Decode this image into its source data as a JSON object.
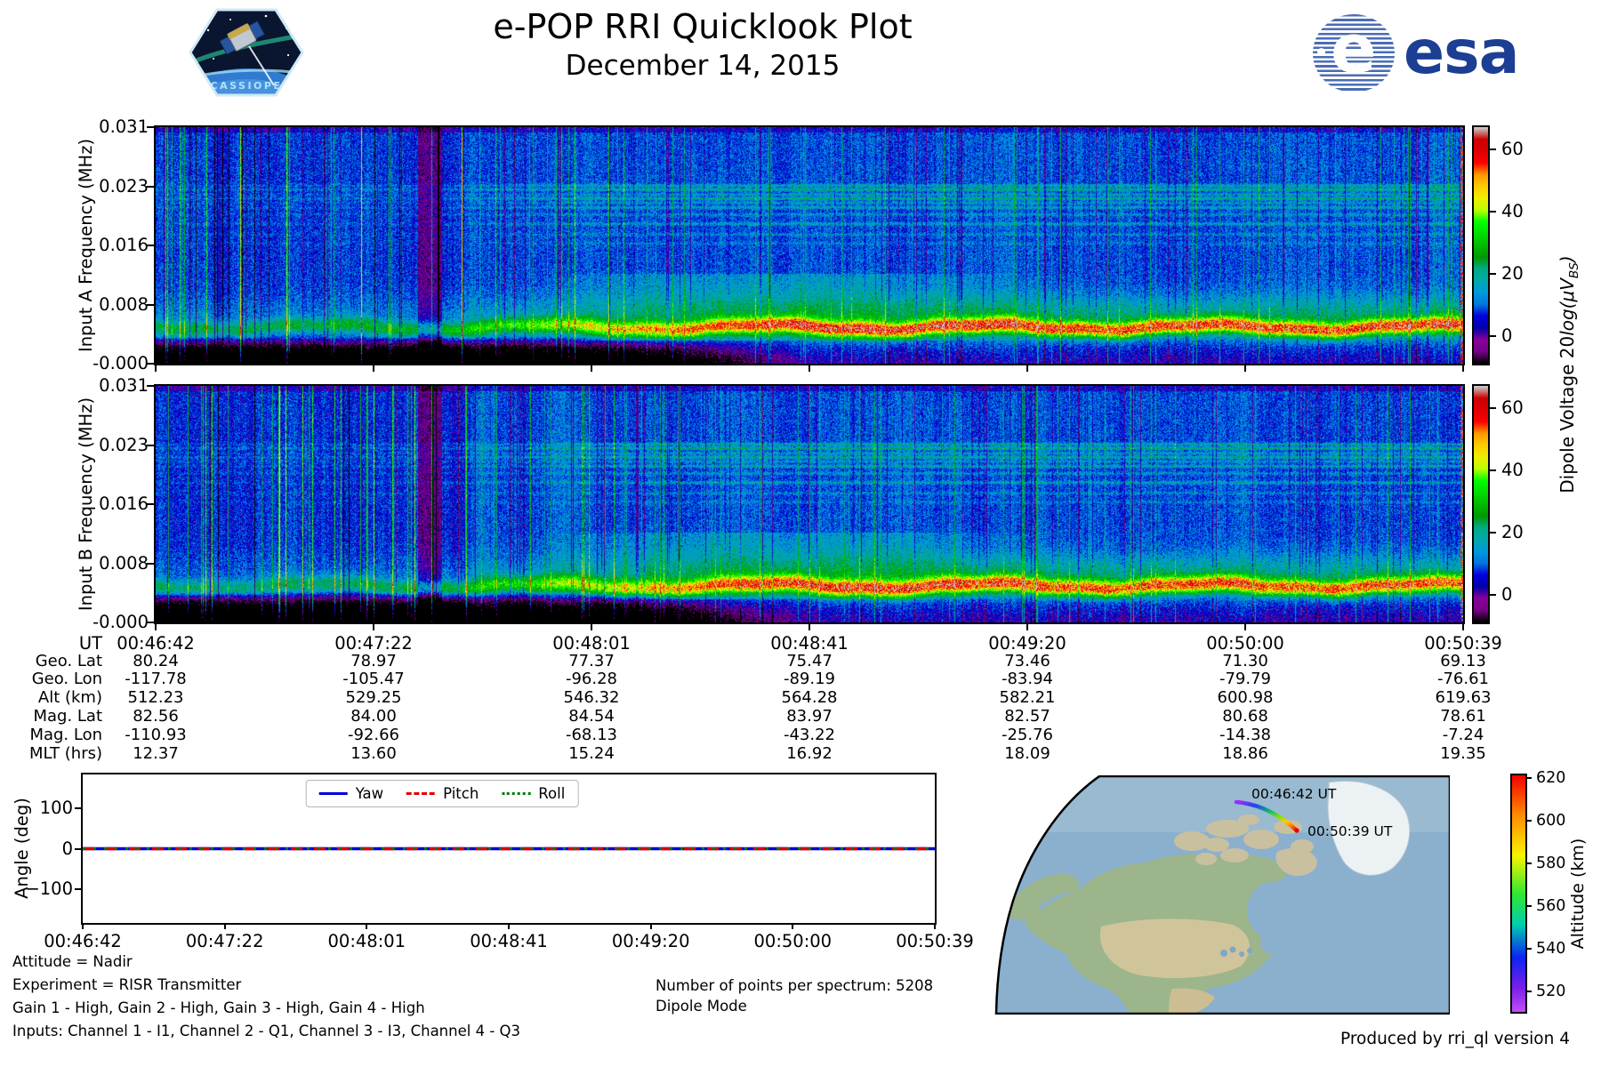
{
  "page": {
    "produced_by": "Produced by rri_ql version 4"
  },
  "colors": {
    "esa_blue": "#1c3f93",
    "accent_black": "#000000"
  },
  "header": {
    "title": "e-POP RRI Quicklook Plot",
    "subtitle": "December 14, 2015",
    "cassiope_badge_label": "CASSIOPE",
    "esa_wordmark": "esa"
  },
  "spectrogram_a": {
    "ylabel": "Input A Frequency (MHz)",
    "yticks": [
      "0.031",
      "0.023",
      "0.016",
      "0.008",
      "-0.000"
    ]
  },
  "spectrogram_b": {
    "ylabel": "Input B Frequency (MHz)",
    "yticks": [
      "0.031",
      "0.023",
      "0.016",
      "0.008",
      "-0.000"
    ]
  },
  "dipole_colorbar": {
    "ticks": [
      "60",
      "40",
      "20",
      "0"
    ],
    "tick_values": [
      60,
      40,
      20,
      0
    ],
    "vmin": -9,
    "vmax": 67,
    "label_prefix": "Dipole Voltage 20",
    "label_log": "log",
    "label_open": "(μV",
    "label_sub": "BS",
    "label_close": ")"
  },
  "ephemeris": {
    "row_labels": [
      "UT",
      "Geo. Lat",
      "Geo. Lon",
      "Alt (km)",
      "Mag. Lat",
      "Mag. Lon",
      "MLT (hrs)"
    ],
    "columns": [
      [
        "00:46:42",
        "80.24",
        "-117.78",
        "512.23",
        "82.56",
        "-110.93",
        "12.37"
      ],
      [
        "00:47:22",
        "78.97",
        "-105.47",
        "529.25",
        "84.00",
        "-92.66",
        "13.60"
      ],
      [
        "00:48:01",
        "77.37",
        "-96.28",
        "546.32",
        "84.54",
        "-68.13",
        "15.24"
      ],
      [
        "00:48:41",
        "75.47",
        "-89.19",
        "564.28",
        "83.97",
        "-43.22",
        "16.92"
      ],
      [
        "00:49:20",
        "73.46",
        "-83.94",
        "582.21",
        "82.57",
        "-25.76",
        "18.09"
      ],
      [
        "00:50:00",
        "71.30",
        "-79.79",
        "600.98",
        "80.68",
        "-14.38",
        "18.86"
      ],
      [
        "00:50:39",
        "69.13",
        "-76.61",
        "619.63",
        "78.61",
        "-7.24",
        "19.35"
      ]
    ]
  },
  "angle_plot": {
    "ylabel": "Angle (deg)",
    "yticks": [
      "100",
      "0",
      "−100"
    ],
    "ytick_values": [
      100,
      0,
      -100
    ],
    "ylim": [
      -185,
      185
    ],
    "xticks": [
      "00:46:42",
      "00:47:22",
      "00:48:01",
      "00:48:41",
      "00:49:20",
      "00:50:00",
      "00:50:39"
    ],
    "legend": [
      {
        "label": "Yaw",
        "color": "#0000dd",
        "style": "solid"
      },
      {
        "label": "Pitch",
        "color": "#e00000",
        "style": "dashed"
      },
      {
        "label": "Roll",
        "color": "#007a00",
        "style": "dotted"
      }
    ]
  },
  "map": {
    "start_label": "00:46:42 UT",
    "end_label": "00:50:39 UT"
  },
  "altitude_colorbar": {
    "label": "Altitude (km)",
    "ticks": [
      "620",
      "600",
      "580",
      "560",
      "540",
      "520"
    ],
    "tick_values": [
      620,
      600,
      580,
      560,
      540,
      520
    ]
  },
  "annotations": {
    "attitude": "Attitude = Nadir",
    "experiment": "Experiment = RISR Transmitter",
    "gains": "Gain 1 - High, Gain 2 - High, Gain 3 - High, Gain 4 - High",
    "inputs": "Inputs: Channel 1 - I1, Channel 2 - Q1, Channel 3 - I3, Channel 4 - Q3",
    "points": "Number of points per spectrum: 5208",
    "mode": "Dipole Mode"
  },
  "chart_data": [
    {
      "type": "heatmap",
      "name": "input_a_spectrogram",
      "xlabel": "UT",
      "ylabel": "Input A Frequency (MHz)",
      "x_ticks": [
        "00:46:42",
        "00:47:22",
        "00:48:01",
        "00:48:41",
        "00:49:20",
        "00:50:00",
        "00:50:39"
      ],
      "y_ticks_mhz": [
        "0.031",
        "0.023",
        "0.016",
        "0.008",
        "-0.000"
      ],
      "colormap": "nipy_spectral",
      "colorbar_label": "Dipole Voltage 20log(μV_BS)",
      "colorbar_ticks_db": [
        60,
        40,
        20,
        0
      ],
      "value_range_db": [
        -9,
        67
      ],
      "features": [
        "blue broadband noise background ~5-15 dB",
        "dense vertical streaking strongest before ~00:47:35",
        "bright green emission band near 0.004-0.006 MHz intensifying toward 00:50:39",
        "horizontal interference lines clustered between 0.017 and 0.024 MHz",
        "near-black region below 0.004 MHz before ~00:48:10",
        "sparse red pixels along right edge"
      ]
    },
    {
      "type": "heatmap",
      "name": "input_b_spectrogram",
      "xlabel": "UT",
      "ylabel": "Input B Frequency (MHz)",
      "x_ticks": [
        "00:46:42",
        "00:47:22",
        "00:48:01",
        "00:48:41",
        "00:49:20",
        "00:50:00",
        "00:50:39"
      ],
      "y_ticks_mhz": [
        "0.031",
        "0.023",
        "0.016",
        "0.008",
        "-0.000"
      ],
      "colormap": "nipy_spectral",
      "colorbar_label": "Dipole Voltage 20log(μV_BS)",
      "colorbar_ticks_db": [
        60,
        40,
        20,
        0
      ],
      "value_range_db": [
        -9,
        67
      ],
      "features": [
        "same structure as Input A with slightly darker low-frequency floor",
        "bright green band near 0.004-0.006 MHz",
        "horizontal interference lines between 0.017 and 0.024 MHz"
      ]
    },
    {
      "type": "line",
      "name": "attitude_angle_plot",
      "ylabel": "Angle (deg)",
      "ylim_deg": [
        -185,
        185
      ],
      "y_ticks_deg": [
        100,
        0,
        -100
      ],
      "x_ticks": [
        "00:46:42",
        "00:47:22",
        "00:48:01",
        "00:48:41",
        "00:49:20",
        "00:50:00",
        "00:50:39"
      ],
      "legend_position": "upper center",
      "series": [
        {
          "name": "Yaw",
          "color": "#0000dd",
          "linestyle": "solid",
          "values_deg": [
            0,
            0,
            0,
            0,
            0,
            0,
            0
          ]
        },
        {
          "name": "Pitch",
          "color": "#e00000",
          "linestyle": "dashed",
          "values_deg": [
            0,
            0,
            0,
            0,
            0,
            0,
            0
          ]
        },
        {
          "name": "Roll",
          "color": "#007a00",
          "linestyle": "dotted",
          "values_deg": [
            0,
            0,
            0,
            0,
            0,
            0,
            0
          ]
        }
      ]
    },
    {
      "type": "table",
      "name": "ephemeris_table",
      "row_labels": [
        "UT",
        "Geo. Lat",
        "Geo. Lon",
        "Alt (km)",
        "Mag. Lat",
        "Mag. Lon",
        "MLT (hrs)"
      ],
      "columns": [
        [
          "00:46:42",
          "80.24",
          "-117.78",
          "512.23",
          "82.56",
          "-110.93",
          "12.37"
        ],
        [
          "00:47:22",
          "78.97",
          "-105.47",
          "529.25",
          "84.00",
          "-92.66",
          "13.60"
        ],
        [
          "00:48:01",
          "77.37",
          "-96.28",
          "546.32",
          "84.54",
          "-68.13",
          "15.24"
        ],
        [
          "00:48:41",
          "75.47",
          "-89.19",
          "564.28",
          "83.97",
          "-43.22",
          "16.92"
        ],
        [
          "00:49:20",
          "73.46",
          "-83.94",
          "582.21",
          "82.57",
          "-25.76",
          "18.09"
        ],
        [
          "00:50:00",
          "71.30",
          "-79.79",
          "600.98",
          "80.68",
          "-14.38",
          "18.86"
        ],
        [
          "00:50:39",
          "69.13",
          "-76.61",
          "619.63",
          "78.61",
          "-7.24",
          "19.35"
        ]
      ]
    },
    {
      "type": "track",
      "name": "ground_track_map",
      "region": "North America and Canadian Arctic, Greenland at right",
      "track_points": [
        {
          "ut": "00:46:42",
          "geo_lat": 80.24,
          "geo_lon": -117.78,
          "alt_km": 512.23
        },
        {
          "ut": "00:47:22",
          "geo_lat": 78.97,
          "geo_lon": -105.47,
          "alt_km": 529.25
        },
        {
          "ut": "00:48:01",
          "geo_lat": 77.37,
          "geo_lon": -96.28,
          "alt_km": 546.32
        },
        {
          "ut": "00:48:41",
          "geo_lat": 75.47,
          "geo_lon": -89.19,
          "alt_km": 564.28
        },
        {
          "ut": "00:49:20",
          "geo_lat": 73.46,
          "geo_lon": -83.94,
          "alt_km": 582.21
        },
        {
          "ut": "00:50:00",
          "geo_lat": 71.3,
          "geo_lon": -79.79,
          "alt_km": 600.98
        },
        {
          "ut": "00:50:39",
          "geo_lat": 69.13,
          "geo_lon": -76.61,
          "alt_km": 619.63
        }
      ],
      "colorbar": {
        "label": "Altitude (km)",
        "ticks_km": [
          620,
          600,
          580,
          560,
          540,
          520
        ],
        "colormap": "rainbow"
      },
      "annotations": [
        "00:46:42 UT",
        "00:50:39 UT"
      ]
    }
  ]
}
